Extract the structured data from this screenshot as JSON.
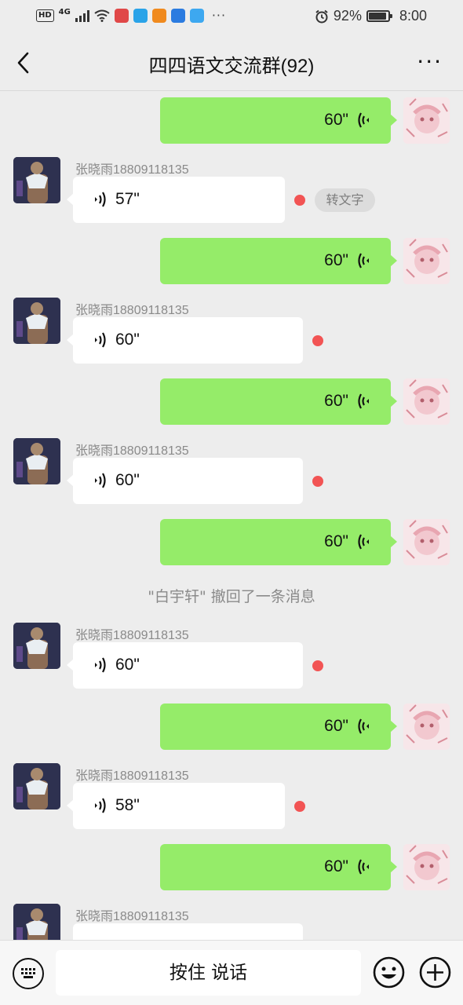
{
  "status_bar": {
    "hd": "HD",
    "network": "4G",
    "battery": "92%",
    "time": "8:00",
    "more": "···",
    "app_icon_colors": [
      "#e04848",
      "#2aa3e8",
      "#f08a1e",
      "#2b7be0",
      "#3da8f0"
    ]
  },
  "nav": {
    "back_icon": "chevron-left-icon",
    "title": "四四语文交流群(92)",
    "more_icon": "more-dots-icon",
    "more": "···"
  },
  "messages": [
    {
      "type": "self",
      "duration": "60\""
    },
    {
      "type": "other",
      "sender": "张晓雨18809118135",
      "duration": "57\"",
      "unread": true,
      "to_text": "转文字"
    },
    {
      "type": "self",
      "duration": "60\""
    },
    {
      "type": "other",
      "sender": "张晓雨18809118135",
      "duration": "60\"",
      "unread": true
    },
    {
      "type": "self",
      "duration": "60\""
    },
    {
      "type": "other",
      "sender": "张晓雨18809118135",
      "duration": "60\"",
      "unread": true
    },
    {
      "type": "self",
      "duration": "60\""
    },
    {
      "type": "system",
      "text": "\"白宇轩\" 撤回了一条消息"
    },
    {
      "type": "other",
      "sender": "张晓雨18809118135",
      "duration": "60\"",
      "unread": true
    },
    {
      "type": "self",
      "duration": "60\""
    },
    {
      "type": "other",
      "sender": "张晓雨18809118135",
      "duration": "58\"",
      "unread": true
    },
    {
      "type": "self",
      "duration": "60\""
    },
    {
      "type": "other",
      "sender": "张晓雨18809118135",
      "duration": "",
      "unread": false
    }
  ],
  "input_bar": {
    "keyboard_icon": "keyboard-icon",
    "hold_to_talk": "按住 说话",
    "emoji_icon": "emoji-icon",
    "plus_icon": "plus-icon"
  },
  "colors": {
    "self_bubble": "#95ec69",
    "other_bubble": "#ffffff",
    "unread_dot": "#f25454",
    "background": "#ededed"
  }
}
